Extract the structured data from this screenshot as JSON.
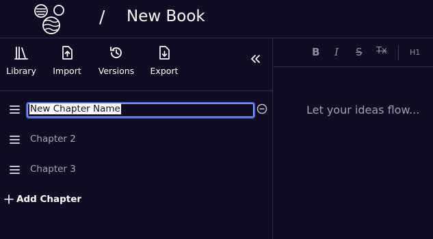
{
  "header": {
    "separator": "/",
    "book_title": "New Book",
    "logo_icon": "planets-logo-icon"
  },
  "toolbar": {
    "items": [
      {
        "label": "Library",
        "icon": "library-books-icon"
      },
      {
        "label": "Import",
        "icon": "file-upload-icon"
      },
      {
        "label": "Versions",
        "icon": "history-icon"
      },
      {
        "label": "Export",
        "icon": "file-download-icon"
      }
    ],
    "collapse_icon": "chevrons-left-icon"
  },
  "chapters": {
    "editing_value": "New Chapter Name",
    "items": [
      {
        "label": "Chapter 2"
      },
      {
        "label": "Chapter 3"
      }
    ],
    "add_label": "Add Chapter"
  },
  "editor": {
    "format_buttons": [
      "B",
      "I",
      "S",
      "Tx",
      "H1"
    ],
    "placeholder": "Let your ideas flow..."
  },
  "colors": {
    "background": "#0f0d24",
    "border": "#2f2c4d",
    "focus_ring": "#4d6ff0",
    "muted_text": "#a7a5b7"
  }
}
